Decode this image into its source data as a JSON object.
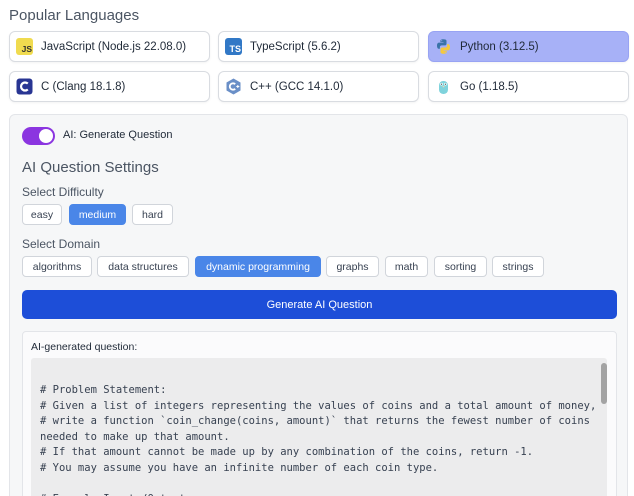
{
  "heading": "Popular Languages",
  "languages": [
    {
      "label": "JavaScript (Node.js 22.08.0)",
      "icon": "javascript-icon",
      "selected": false
    },
    {
      "label": "TypeScript (5.6.2)",
      "icon": "typescript-icon",
      "selected": false
    },
    {
      "label": "Python (3.12.5)",
      "icon": "python-icon",
      "selected": true
    },
    {
      "label": "C (Clang 18.1.8)",
      "icon": "c-icon",
      "selected": false
    },
    {
      "label": "C++ (GCC 14.1.0)",
      "icon": "cpp-icon",
      "selected": false
    },
    {
      "label": "Go (1.18.5)",
      "icon": "go-icon",
      "selected": false
    }
  ],
  "icon_text": {
    "js": "JS",
    "ts": "TS"
  },
  "ai": {
    "toggle_label": "AI: Generate Question",
    "toggle_on": true,
    "settings_title": "AI Question Settings",
    "difficulty_label": "Select Difficulty",
    "difficulties": [
      "easy",
      "medium",
      "hard"
    ],
    "selected_difficulty": "medium",
    "domain_label": "Select Domain",
    "domains": [
      "algorithms",
      "data structures",
      "dynamic programming",
      "graphs",
      "math",
      "sorting",
      "strings"
    ],
    "selected_domain": "dynamic programming",
    "generate_label": "Generate AI Question",
    "output_label": "AI-generated question:",
    "code": "# Problem Statement:\n# Given a list of integers representing the values of coins and a total amount of money,\n# write a function `coin_change(coins, amount)` that returns the fewest number of coins\nneeded to make up that amount.\n# If that amount cannot be made up by any combination of the coins, return -1.\n# You may assume you have an infinite number of each coin type.\n\n# Example Inputs/Outputs:"
  },
  "colors": {
    "accent": "#1d4ed8",
    "chip_active": "#4a86e8",
    "toggle": "#8b35e0",
    "lang_selected": "#a7b1f7"
  }
}
